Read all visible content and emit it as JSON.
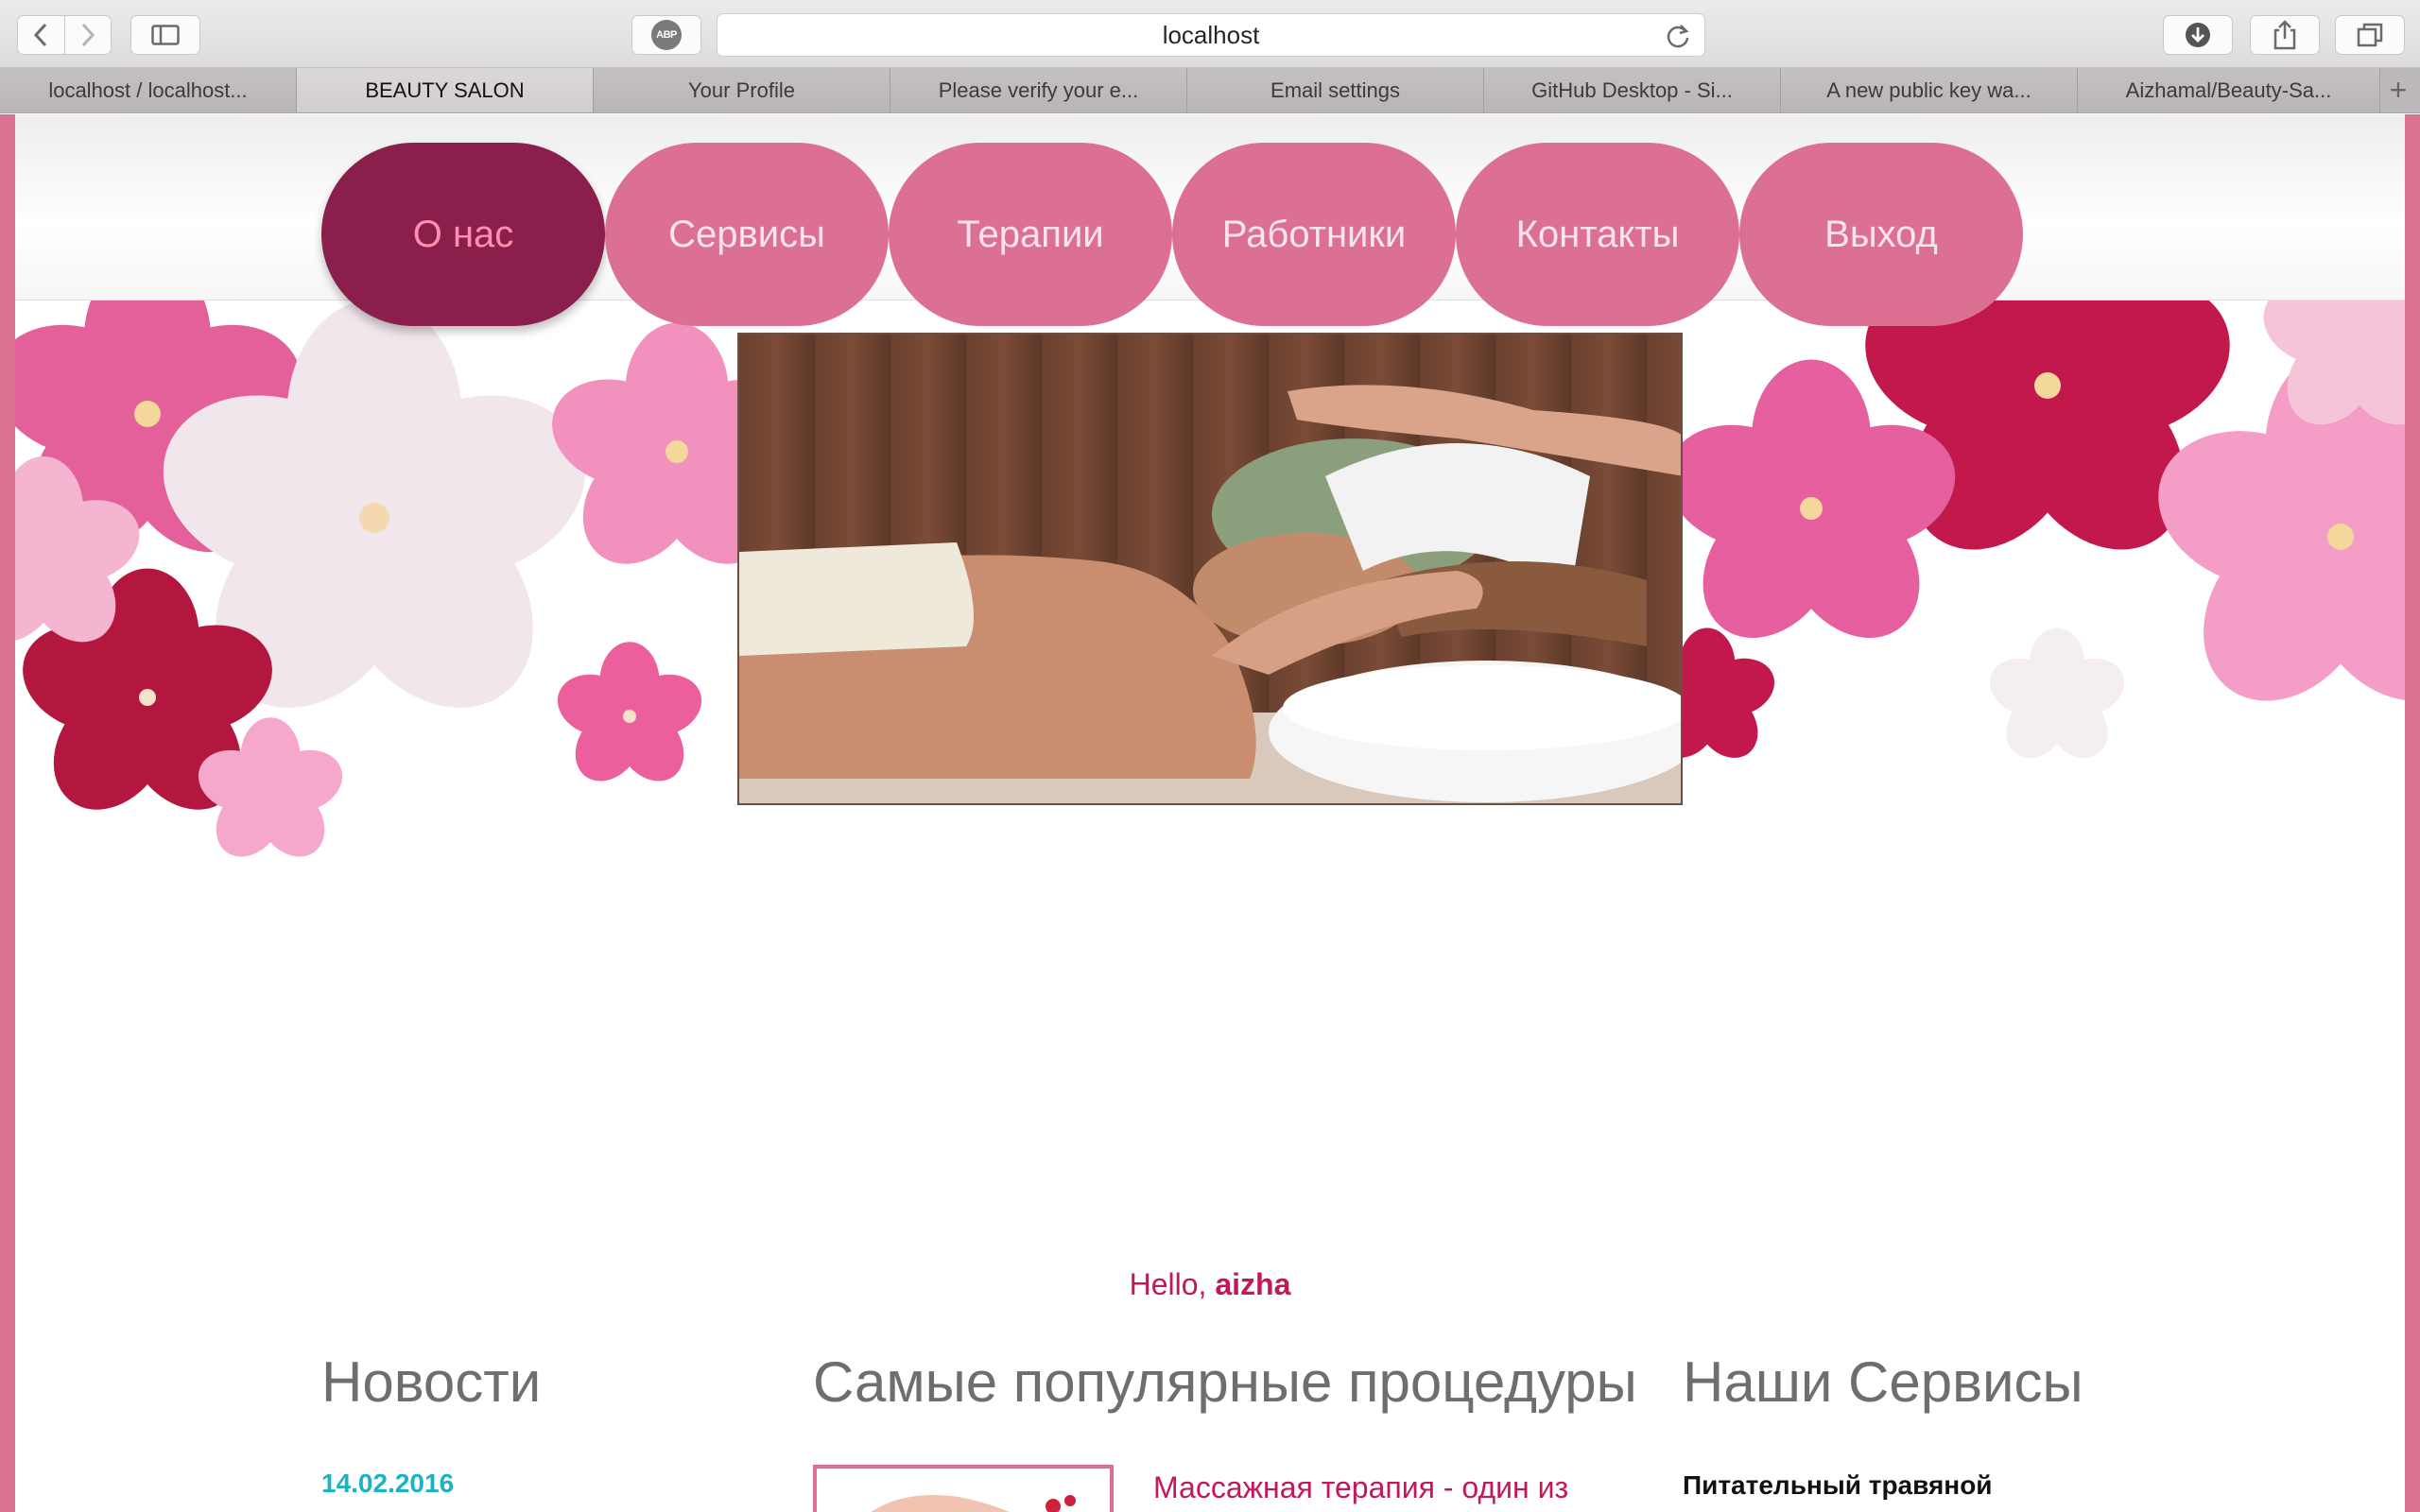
{
  "browser": {
    "url": "localhost",
    "abp_label": "ABP",
    "tabs": [
      {
        "label": "localhost / localhost..."
      },
      {
        "label": "BEAUTY SALON"
      },
      {
        "label": "Your Profile"
      },
      {
        "label": "Please verify your e..."
      },
      {
        "label": "Email settings"
      },
      {
        "label": "GitHub Desktop - Si..."
      },
      {
        "label": "A new public key wa..."
      },
      {
        "label": "Aizhamal/Beauty-Sa..."
      }
    ],
    "new_tab": "+"
  },
  "nav": {
    "items": [
      {
        "label": "О нас"
      },
      {
        "label": "Сервисы"
      },
      {
        "label": "Терапии"
      },
      {
        "label": "Работники"
      },
      {
        "label": "Контакты"
      },
      {
        "label": "Выход"
      }
    ],
    "active_color": "#8b1f4c",
    "item_color": "#db7093"
  },
  "greeting": {
    "prefix": "Hello, ",
    "username": "aizha"
  },
  "news": {
    "title": "Новости",
    "date": "14.02.2016"
  },
  "popular": {
    "title": "Самые популярные процедуры",
    "first_item": "Массажная терапия - один из"
  },
  "services": {
    "title": "Наши Сервисы",
    "first_item": "Питательный травяной"
  },
  "colors": {
    "accent": "#c2185b",
    "date": "#1bb3c4",
    "frame": "#d97391"
  }
}
